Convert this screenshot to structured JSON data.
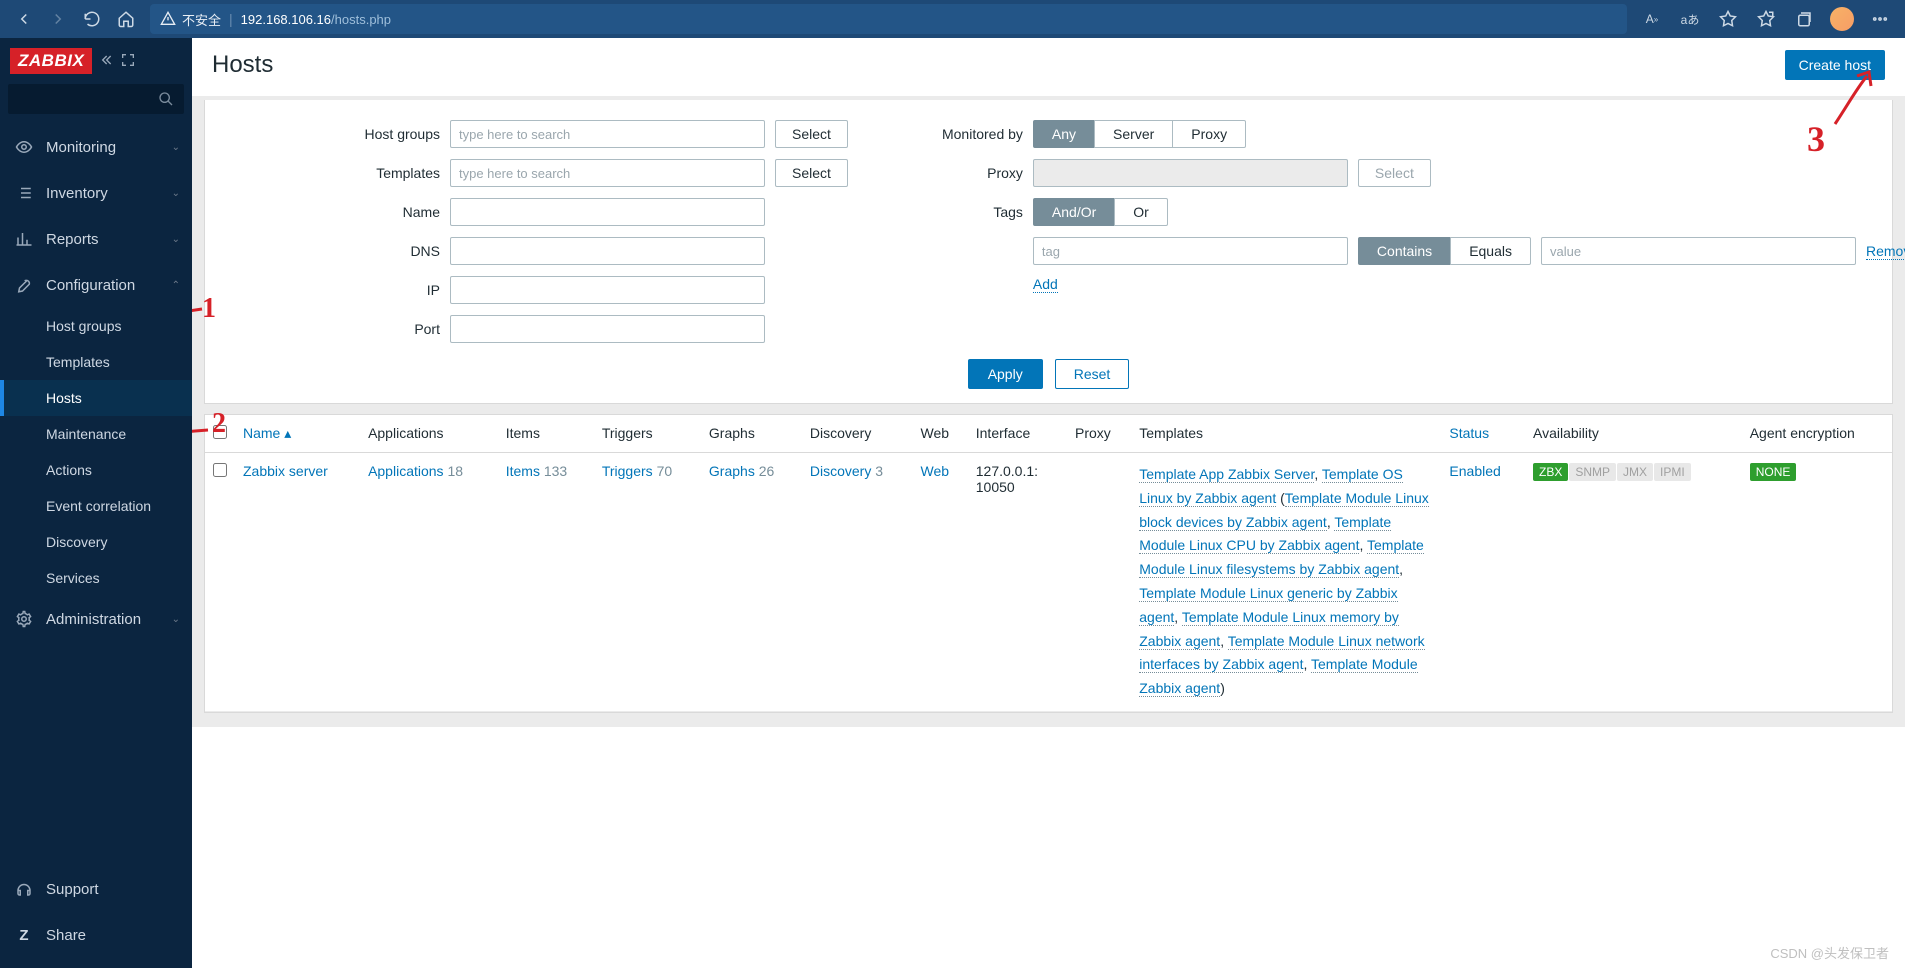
{
  "browser": {
    "insecure_label": "不安全",
    "url_host": "192.168.106.16",
    "url_path": "/hosts.php"
  },
  "sidebar": {
    "logo": "ZABBIX",
    "menu": {
      "monitoring": "Monitoring",
      "inventory": "Inventory",
      "reports": "Reports",
      "configuration": "Configuration",
      "administration": "Administration",
      "support": "Support",
      "share": "Share"
    },
    "config_items": {
      "host_groups": "Host groups",
      "templates": "Templates",
      "hosts": "Hosts",
      "maintenance": "Maintenance",
      "actions": "Actions",
      "event_correlation": "Event correlation",
      "discovery": "Discovery",
      "services": "Services"
    }
  },
  "page": {
    "title": "Hosts",
    "create_button": "Create host"
  },
  "filter": {
    "host_groups": {
      "label": "Host groups",
      "placeholder": "type here to search",
      "select": "Select"
    },
    "templates": {
      "label": "Templates",
      "placeholder": "type here to search",
      "select": "Select"
    },
    "name": {
      "label": "Name"
    },
    "dns": {
      "label": "DNS"
    },
    "ip": {
      "label": "IP"
    },
    "port": {
      "label": "Port"
    },
    "monitored_by": {
      "label": "Monitored by",
      "any": "Any",
      "server": "Server",
      "proxy": "Proxy"
    },
    "proxy": {
      "label": "Proxy",
      "select": "Select"
    },
    "tags": {
      "label": "Tags",
      "andor": "And/Or",
      "or": "Or",
      "tag_placeholder": "tag",
      "contains": "Contains",
      "equals": "Equals",
      "value_placeholder": "value",
      "remove": "Remove",
      "add": "Add"
    },
    "apply": "Apply",
    "reset": "Reset"
  },
  "table": {
    "headers": {
      "name": "Name",
      "applications": "Applications",
      "items": "Items",
      "triggers": "Triggers",
      "graphs": "Graphs",
      "discovery": "Discovery",
      "web": "Web",
      "interface": "Interface",
      "proxy": "Proxy",
      "templates": "Templates",
      "status": "Status",
      "availability": "Availability",
      "agent_encryption": "Agent encryption"
    },
    "rows": [
      {
        "name": "Zabbix server",
        "apps_label": "Applications",
        "apps": 18,
        "items_label": "Items",
        "items": 133,
        "triggers_label": "Triggers",
        "triggers": 70,
        "graphs_label": "Graphs",
        "graphs": 26,
        "discovery_label": "Discovery",
        "discovery": 3,
        "web": "Web",
        "interface": "127.0.0.1: 10050",
        "templates": [
          "Template App Zabbix Server",
          "Template OS Linux by Zabbix agent",
          "Template Module Linux block devices by Zabbix agent",
          "Template Module Linux CPU by Zabbix agent",
          "Template Module Linux filesystems by Zabbix agent",
          "Template Module Linux generic by Zabbix agent",
          "Template Module Linux memory by Zabbix agent",
          "Template Module Linux network interfaces by Zabbix agent",
          "Template Module Zabbix agent"
        ],
        "status": "Enabled",
        "avail_zbx": "ZBX",
        "avail_snmp": "SNMP",
        "avail_jmx": "JMX",
        "avail_ipmi": "IPMI",
        "enc": "NONE"
      }
    ]
  },
  "watermark": "CSDN @头发保卫者"
}
